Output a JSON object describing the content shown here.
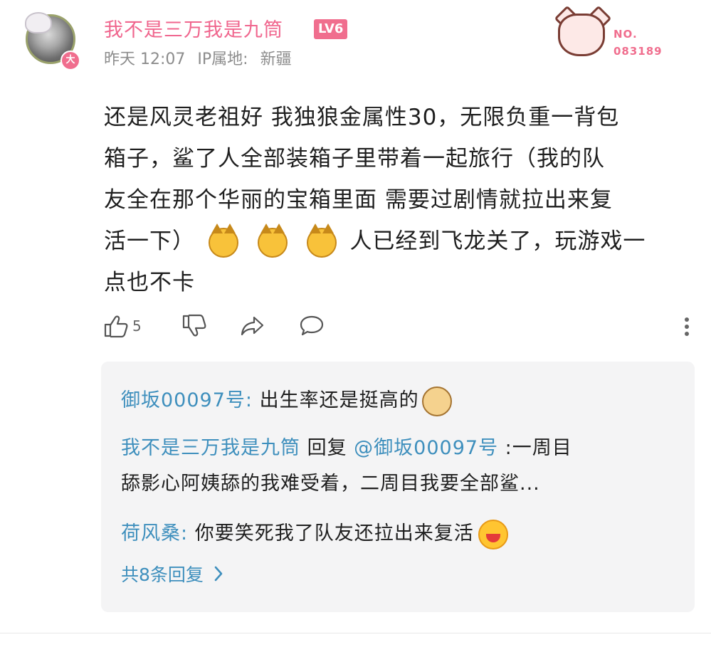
{
  "post": {
    "username": "我不是三万我是九筒",
    "level": "LV6",
    "avatar_badge": "大",
    "time": "昨天 12:07",
    "ip_label": "IP属地:",
    "ip_location": "新疆",
    "fan_badge_label": "NO.",
    "fan_badge_number": "083189",
    "content_lines": [
      "还是风灵老祖好 我独狼金属性30，无限负重一背包",
      "箱子，鲨了人全部装箱子里带着一起旅行（我的队",
      "友全在那个华丽的宝箱里面 需要过剧情就拉出来复"
    ],
    "content_line4_prefix": "活一下）",
    "content_line4_suffix": "人已经到飞龙关了，玩游戏一",
    "content_line5": "点也不卡",
    "like_count": "5"
  },
  "replies": [
    {
      "name": "御坂00097号",
      "sep": ":",
      "text": " 出生率还是挺高的"
    },
    {
      "name": "我不是三万我是九筒",
      "reply_word": " 回复 ",
      "mention": "@御坂00097号",
      "text": " :一周目",
      "text2": "舔影心阿姨舔的我难受着，二周目我要全部鲨..."
    },
    {
      "name": "荷风桑",
      "sep": ":",
      "text": " 你要笑死我了队友还拉出来复活"
    }
  ],
  "more_replies_label": "共8条回复",
  "icons": {
    "like": "thumbs-up-icon",
    "dislike": "thumbs-down-icon",
    "share": "share-icon",
    "comment": "comment-icon",
    "more": "more-vertical-icon"
  },
  "colors": {
    "username": "#f0668e",
    "level_badge": "#f06e8e",
    "reply_name": "#3e8fbd",
    "reply_bg": "#f4f4f5"
  }
}
